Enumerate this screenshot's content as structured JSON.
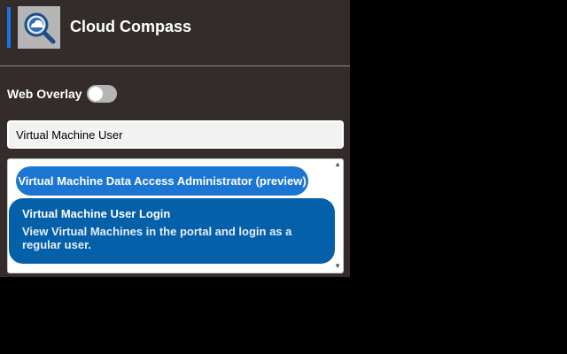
{
  "header": {
    "app_title": "Cloud Compass",
    "logo_icon": "cloud-search-magnifier-icon",
    "accent_color": "#1a73e8"
  },
  "overlay": {
    "label": "Web Overlay",
    "enabled": false
  },
  "search": {
    "value": "Virtual Machine User"
  },
  "results": {
    "items": [
      {
        "title": "Virtual Machine Data Access Administrator (preview)"
      },
      {
        "title": "Virtual Machine User Login",
        "description": "View Virtual Machines in the portal and login as a regular user."
      }
    ]
  },
  "colors": {
    "panel_bg": "#332c2b",
    "pill_bg": "#1a76d2",
    "selected_bg": "#0560aa"
  }
}
